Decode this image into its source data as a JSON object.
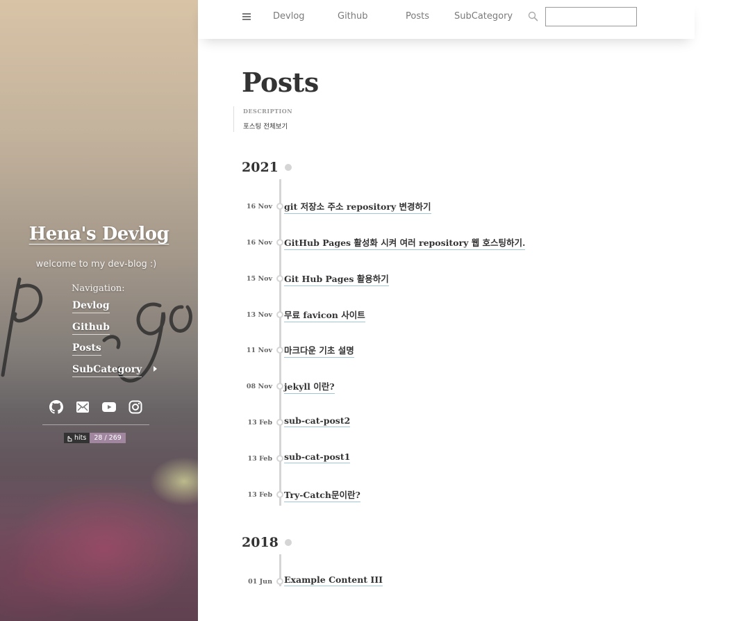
{
  "sidebar": {
    "title": "Hena's Devlog",
    "tagline": "welcome to my dev-blog :)",
    "nav_heading": "Navigation:",
    "nav_items": [
      {
        "label": "Devlog"
      },
      {
        "label": "Github"
      },
      {
        "label": "Posts"
      },
      {
        "label": "SubCategory",
        "has_submenu": true
      }
    ],
    "social_icons": [
      "github-icon",
      "mail-icon",
      "youtube-icon",
      "instagram-icon"
    ],
    "hits": {
      "label": "hits",
      "value": "28 / 269"
    }
  },
  "topnav": {
    "items": [
      "Devlog",
      "Github",
      "Posts",
      "SubCategory"
    ],
    "search": {
      "placeholder": "",
      "value": ""
    }
  },
  "page": {
    "title": "Posts",
    "description_label": "DESCRIPTION",
    "description": "포스팅 전체보기"
  },
  "archive": [
    {
      "year": "2021",
      "posts": [
        {
          "date": "16 Nov",
          "title": "git 저장소 주소 repository 변경하기"
        },
        {
          "date": "16 Nov",
          "title": "GitHub Pages 활성화 시켜 여러 repository 웹 호스팅하기."
        },
        {
          "date": "15 Nov",
          "title": "Git Hub Pages 활용하기"
        },
        {
          "date": "13 Nov",
          "title": "무료 favicon 사이트"
        },
        {
          "date": "11 Nov",
          "title": "마크다운 기초 설명"
        },
        {
          "date": "08 Nov",
          "title": "jekyll 이란?"
        },
        {
          "date": "13 Feb",
          "title": "sub-cat-post2"
        },
        {
          "date": "13 Feb",
          "title": "sub-cat-post1"
        },
        {
          "date": "13 Feb",
          "title": "Try-Catch문이란?"
        }
      ]
    },
    {
      "year": "2018",
      "posts": [
        {
          "date": "01 Jun",
          "title": "Example Content III"
        }
      ]
    }
  ],
  "colors": {
    "accent_underline": "#9fc6d6",
    "timeline": "#d5d5d5",
    "hits_badge": "#a186a0"
  }
}
